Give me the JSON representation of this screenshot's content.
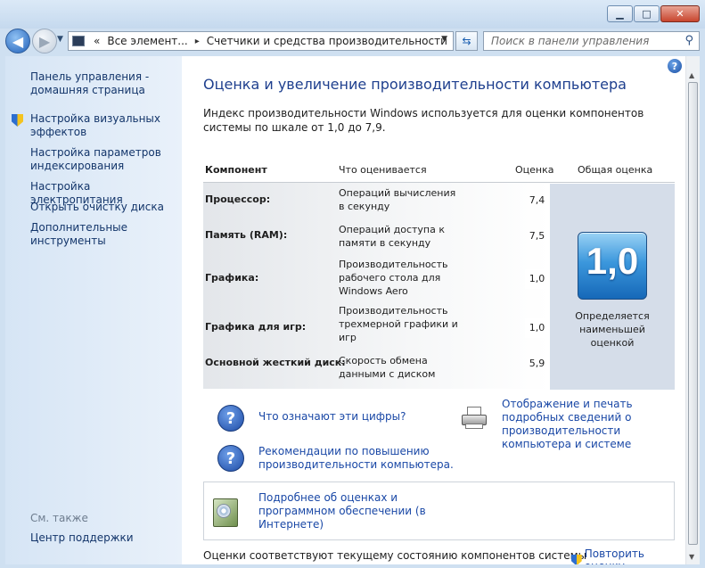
{
  "window": {
    "minimize_glyph": "▁",
    "maximize_glyph": "□",
    "close_glyph": "✕"
  },
  "nav": {
    "back_glyph": "◀",
    "forward_glyph": "▶",
    "history_glyph": "▼",
    "breadcrumb_prefix": "«",
    "breadcrumb": [
      "Все элемент...",
      "Счетчики и средства производительности"
    ],
    "breadcrumb_sep": "▸",
    "dropdown_glyph": "▼",
    "refresh_glyph": "⇆",
    "search_placeholder": "Поиск в панели управления",
    "search_glyph": "⚲"
  },
  "sidebar": {
    "items": [
      {
        "label": "Панель управления - домашняя страница",
        "shield": false
      },
      {
        "label": "Настройка визуальных эффектов",
        "shield": true
      },
      {
        "label": "Настройка параметров индексирования",
        "shield": false
      },
      {
        "label": "Настройка электропитания",
        "shield": false
      },
      {
        "label": "Открыть очистку диска",
        "shield": false
      },
      {
        "label": "Дополнительные инструменты",
        "shield": false
      }
    ],
    "see_also_label": "См. также",
    "see_also_items": [
      "Центр поддержки"
    ]
  },
  "main": {
    "help_glyph": "?",
    "title": "Оценка и увеличение производительности компьютера",
    "intro": "Индекс производительности Windows используется для оценки компонентов системы по шкале от 1,0 до 7,9.",
    "table": {
      "headers": {
        "component": "Компонент",
        "what": "Что оценивается",
        "score": "Оценка",
        "overall": "Общая оценка"
      },
      "rows": [
        {
          "component": "Процессор:",
          "what": "Операций вычисления в секунду",
          "score": "7,4",
          "highlight": false
        },
        {
          "component": "Память (RAM):",
          "what": "Операций доступа к памяти в секунду",
          "score": "7,5",
          "highlight": false
        },
        {
          "component": "Графика:",
          "what": "Производительность рабочего стола для Windows Aero",
          "score": "1,0",
          "highlight": true
        },
        {
          "component": "Графика для игр:",
          "what": "Производительность трехмерной графики и игр",
          "score": "1,0",
          "highlight": true
        },
        {
          "component": "Основной жесткий диск:",
          "what": "Скорость обмена данными с диском",
          "score": "5,9",
          "highlight": false
        }
      ],
      "overall_score": "1,0",
      "overall_caption": "Определяется наименьшей оценкой"
    },
    "links": {
      "what_numbers": "Что означают эти цифры?",
      "tips": "Рекомендации по повышению производительности компьютера.",
      "print_details": "Отображение и печать подробных сведений о производительности компьютера и системе",
      "more_info": "Подробнее об оценках и программном обеспечении (в Интернете)"
    },
    "question_glyph": "?",
    "footer_text": "Оценки соответствуют текущему состоянию компонентов системы",
    "rerun_label": "Повторить оценку"
  },
  "scrollbar": {
    "up_glyph": "▲",
    "down_glyph": "▼"
  },
  "colors": {
    "link": "#1a48a6",
    "title": "#1e3f8e",
    "sidebar_bg": "#d6e5f5",
    "badge": "#3b97dc"
  },
  "icons": [
    "back-arrow-icon",
    "forward-arrow-icon",
    "control-panel-icon",
    "refresh-icon",
    "search-icon",
    "help-icon",
    "shield-icon",
    "question-icon",
    "printer-icon",
    "software-box-icon"
  ]
}
